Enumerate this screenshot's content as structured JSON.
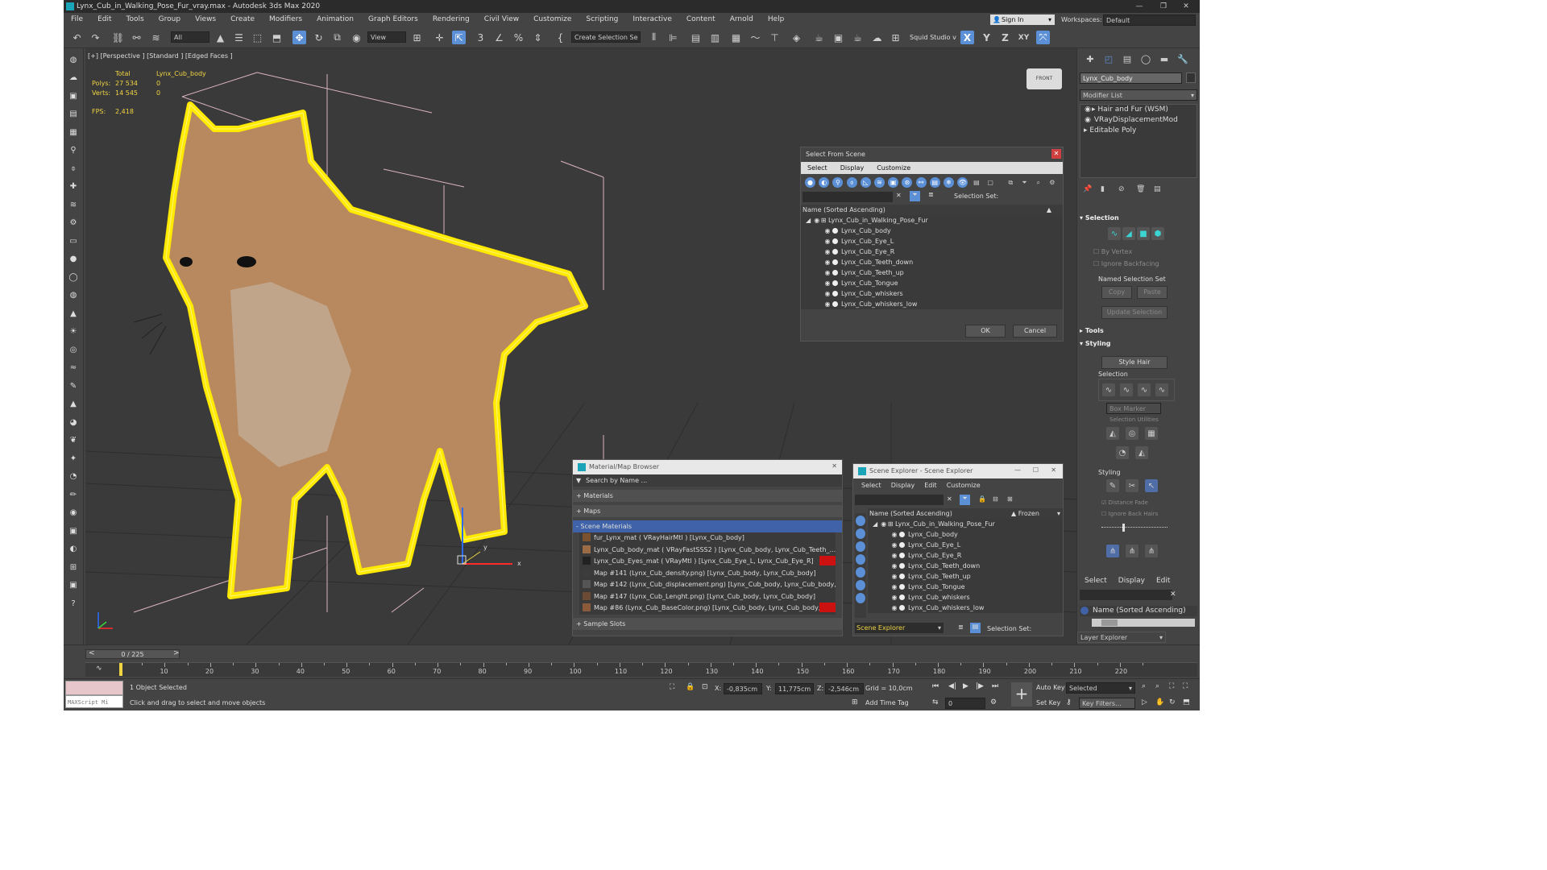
{
  "title": "Lynx_Cub_in_Walking_Pose_Fur_vray.max - Autodesk 3ds Max 2020",
  "menu": [
    "File",
    "Edit",
    "Tools",
    "Group",
    "Views",
    "Create",
    "Modifiers",
    "Animation",
    "Graph Editors",
    "Rendering",
    "Civil View",
    "Customize",
    "Scripting",
    "Interactive",
    "Content",
    "Arnold",
    "Help"
  ],
  "signin": "Sign In",
  "workspaces_label": "Workspaces:",
  "workspace": "Default",
  "toolbar": {
    "filter": "All",
    "view": "View",
    "selection_set": "Create Selection Se",
    "squid": "Squid Studio v",
    "x": "X",
    "y": "Y",
    "z": "Z",
    "xy": "XY"
  },
  "viewport": {
    "label": "[+] [Perspective ] [Standard ] [Edged Faces ]",
    "total": "Total",
    "object": "Lynx_Cub_body",
    "polys_label": "Polys:",
    "polys_total": "27 534",
    "polys_obj": "0",
    "verts_label": "Verts:",
    "verts_total": "14 545",
    "verts_obj": "0",
    "fps_label": "FPS:",
    "fps": "2,418",
    "viewcube": "FRONT",
    "ax_x": "x",
    "ax_y": "y"
  },
  "select_dialog": {
    "title": "Select From Scene",
    "menu": [
      "Select",
      "Display",
      "Customize"
    ],
    "col": "Name (Sorted Ascending)",
    "sel_set": "Selection Set:",
    "root": "Lynx_Cub_in_Walking_Pose_Fur",
    "items": [
      "Lynx_Cub_body",
      "Lynx_Cub_Eye_L",
      "Lynx_Cub_Eye_R",
      "Lynx_Cub_Teeth_down",
      "Lynx_Cub_Teeth_up",
      "Lynx_Cub_Tongue",
      "Lynx_Cub_whiskers",
      "Lynx_Cub_whiskers_low"
    ],
    "ok": "OK",
    "cancel": "Cancel"
  },
  "mat_browser": {
    "title": "Material/Map Browser",
    "search": "Search by Name ...",
    "materials": "+ Materials",
    "maps": "+ Maps",
    "scene": "- Scene Materials",
    "rows": [
      "fur_Lynx_mat ( VRayHairMtl ) [Lynx_Cub_body]",
      "Lynx_Cub_body_mat ( VRayFastSSS2 ) [Lynx_Cub_body, Lynx_Cub_Teeth_...",
      "Lynx_Cub_Eyes_mat ( VRayMtl ) [Lynx_Cub_Eye_L, Lynx_Cub_Eye_R]",
      "Map #141 (Lynx_Cub_density.png) [Lynx_Cub_body, Lynx_Cub_body]",
      "Map #142 (Lynx_Cub_displacement.png) [Lynx_Cub_body, Lynx_Cub_body,...",
      "Map #147 (Lynx_Cub_Lenght.png) [Lynx_Cub_body, Lynx_Cub_body]",
      "Map #86 (Lynx_Cub_BaseColor.png) [Lynx_Cub_body, Lynx_Cub_body, Lynx..."
    ],
    "slots": "+ Sample Slots"
  },
  "scene_explorer": {
    "title": "Scene Explorer - Scene Explorer",
    "menu": [
      "Select",
      "Display",
      "Edit",
      "Customize"
    ],
    "col": "Name (Sorted Ascending)",
    "frozen": "▲ Frozen",
    "root": "Lynx_Cub_in_Walking_Pose_Fur",
    "items": [
      "Lynx_Cub_body",
      "Lynx_Cub_Eye_L",
      "Lynx_Cub_Eye_R",
      "Lynx_Cub_Teeth_down",
      "Lynx_Cub_Teeth_up",
      "Lynx_Cub_Tongue",
      "Lynx_Cub_whiskers",
      "Lynx_Cub_whiskers_low"
    ],
    "footer": "Scene Explorer",
    "sel_set": "Selection Set:"
  },
  "cmd": {
    "object": "Lynx_Cub_body",
    "modlist": "Modifier List",
    "modifiers": [
      "Hair and Fur (WSM)",
      "VRayDisplacementMod",
      "Editable Poly"
    ],
    "selection": "Selection",
    "by_vertex": "By Vertex",
    "ignore_backfacing": "Ignore Backfacing",
    "named_sel": "Named Selection Set",
    "copy": "Copy",
    "paste": "Paste",
    "update": "Update Selection",
    "tools": "Tools",
    "styling": "Styling",
    "style_hair": "Style Hair",
    "selection2": "Selection",
    "box_marker": "Box Marker",
    "sel_util": "Selection Utilities",
    "styling2": "Styling",
    "distance_fade": "Distance Fade",
    "ignore_back": "Ignore Back Hairs",
    "lower_menu": [
      "Select",
      "Display",
      "Edit"
    ],
    "lower_col": "Name (Sorted Ascending)",
    "layer": "Layer Explorer"
  },
  "timeline": {
    "frame": "0 / 225",
    "ticks": [
      "10",
      "20",
      "30",
      "40",
      "50",
      "60",
      "70",
      "80",
      "90",
      "100",
      "110",
      "120",
      "130",
      "140",
      "150",
      "160",
      "170",
      "180",
      "190",
      "200",
      "210",
      "220"
    ]
  },
  "status": {
    "maxscript": "MAXScript Mi",
    "selected": "1 Object Selected",
    "hint": "Click and drag to select and move objects",
    "x": "X:",
    "xv": "-0,835cm",
    "y": "Y:",
    "yv": "11,775cm",
    "z": "Z:",
    "zv": "-2,546cm",
    "grid": "Grid = 10,0cm",
    "addtag": "Add Time Tag",
    "autokey": "Auto Key",
    "setkey": "Set Key",
    "selected_dd": "Selected",
    "keyfilters": "Key Filters...",
    "frame": "0"
  }
}
